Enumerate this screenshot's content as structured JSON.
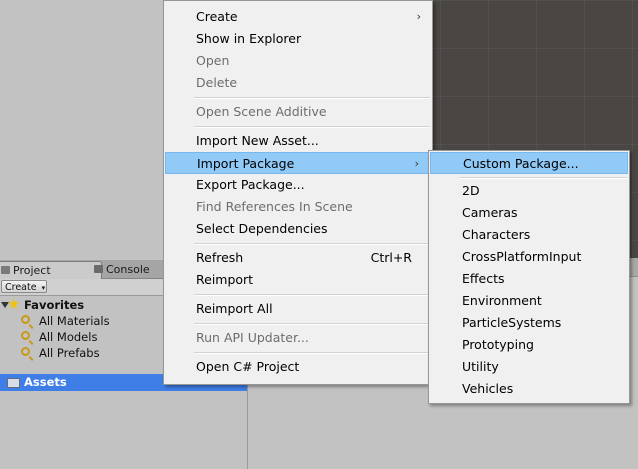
{
  "project_panel": {
    "tabs": [
      {
        "label": "Project"
      },
      {
        "label": "Console"
      }
    ],
    "create_button": "Create",
    "favorites": {
      "label": "Favorites",
      "items": [
        {
          "label": "All Materials"
        },
        {
          "label": "All Models"
        },
        {
          "label": "All Prefabs"
        }
      ]
    },
    "assets_label": "Assets"
  },
  "context_menu": {
    "items": [
      {
        "label": "Create",
        "enabled": true,
        "submenu": true
      },
      {
        "label": "Show in Explorer",
        "enabled": true
      },
      {
        "label": "Open",
        "enabled": false
      },
      {
        "label": "Delete",
        "enabled": false
      },
      {
        "label": "Open Scene Additive",
        "enabled": false
      },
      {
        "label": "Import New Asset...",
        "enabled": true
      },
      {
        "label": "Import Package",
        "enabled": true,
        "submenu": true,
        "highlighted": true
      },
      {
        "label": "Export Package...",
        "enabled": true
      },
      {
        "label": "Find References In Scene",
        "enabled": false
      },
      {
        "label": "Select Dependencies",
        "enabled": true
      },
      {
        "label": "Refresh",
        "enabled": true,
        "shortcut": "Ctrl+R"
      },
      {
        "label": "Reimport",
        "enabled": true
      },
      {
        "label": "Reimport All",
        "enabled": true
      },
      {
        "label": "Run API Updater...",
        "enabled": false
      },
      {
        "label": "Open C# Project",
        "enabled": true
      }
    ]
  },
  "import_package_submenu": {
    "items": [
      {
        "label": "Custom Package...",
        "highlighted": true
      },
      {
        "label": "2D"
      },
      {
        "label": "Cameras"
      },
      {
        "label": "Characters"
      },
      {
        "label": "CrossPlatformInput"
      },
      {
        "label": "Effects"
      },
      {
        "label": "Environment"
      },
      {
        "label": "ParticleSystems"
      },
      {
        "label": "Prototyping"
      },
      {
        "label": "Utility"
      },
      {
        "label": "Vehicles"
      }
    ]
  },
  "colors": {
    "highlight": "#91c9f7",
    "selection": "#3e7ee6",
    "menu_bg": "#f0f0f0",
    "scene_bg": "#4a4643"
  }
}
